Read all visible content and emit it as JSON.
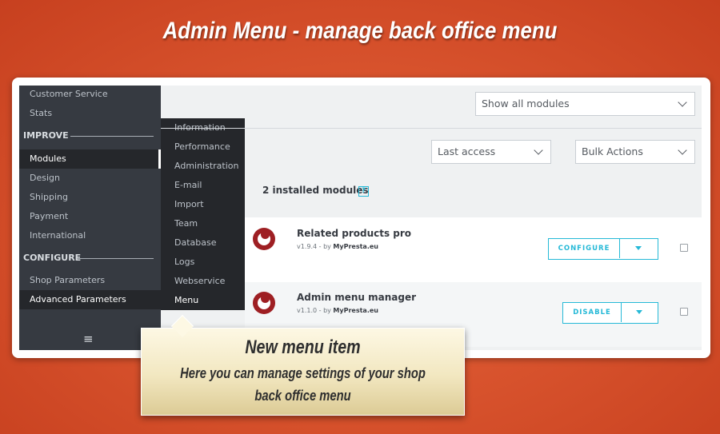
{
  "headline": "Admin Menu - manage back office menu",
  "sidebar": {
    "items_top": [
      "Customer Service",
      "Stats"
    ],
    "section_improve": "IMPROVE",
    "items_improve": [
      "Modules",
      "Design",
      "Shipping",
      "Payment",
      "International"
    ],
    "section_configure": "CONFIGURE",
    "items_configure": [
      "Shop Parameters",
      "Advanced Parameters"
    ],
    "menu_icon": "hamburger-icon"
  },
  "submenu": {
    "items": [
      "Information",
      "Performance",
      "Administration",
      "E-mail",
      "Import",
      "Team",
      "Database",
      "Logs",
      "Webservice",
      "Menu"
    ]
  },
  "filters": {
    "show_modules": "Show all modules",
    "sort": "Last access",
    "bulk": "Bulk Actions"
  },
  "module_count": "2 installed modules",
  "help_icon": "?",
  "modules": [
    {
      "name": "Related products pro",
      "version": "v1.9.4 - by ",
      "author": "MyPresta.eu",
      "action": "CONFIGURE"
    },
    {
      "name": "Admin menu manager",
      "version": "v1.1.0 - by ",
      "author": "MyPresta.eu",
      "action": "DISABLE"
    }
  ],
  "callout": {
    "title": "New menu item",
    "line1": "Here you can manage settings of  your shop",
    "line2": "back office menu"
  },
  "colors": {
    "background": "#d9542e",
    "sidebar": "#363a41",
    "submenu": "#25272b",
    "accent": "#25b9d7",
    "module_logo": "#9e1f23"
  }
}
